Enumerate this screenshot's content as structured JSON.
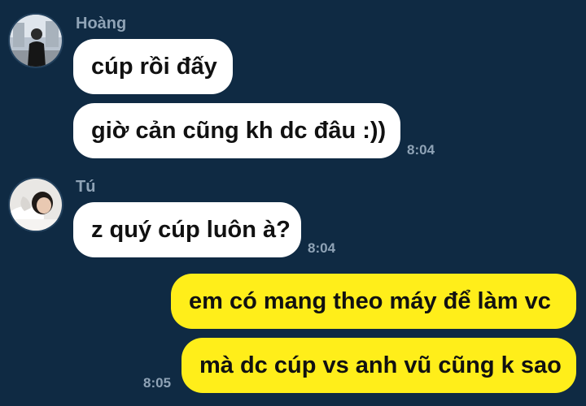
{
  "colors": {
    "background": "#0f2a43",
    "incoming_bubble": "#ffffff",
    "outgoing_bubble": "#ffee1a",
    "meta_text": "#8fa3b6"
  },
  "messages": {
    "hoang": {
      "sender": "Hoàng",
      "avatar_icon": "user-avatar-photo-icon",
      "line1": "cúp rồi đấy",
      "line2": "giờ cản cũng kh dc đâu :))",
      "time": "8:04"
    },
    "tu": {
      "sender": "Tú",
      "avatar_icon": "user-avatar-photo-icon",
      "line1": "z quý cúp luôn à?",
      "time": "8:04"
    },
    "me": {
      "line1": "em có mang theo máy để làm vc",
      "line2": "mà dc cúp vs anh vũ cũng k sao",
      "time": "8:05"
    }
  }
}
